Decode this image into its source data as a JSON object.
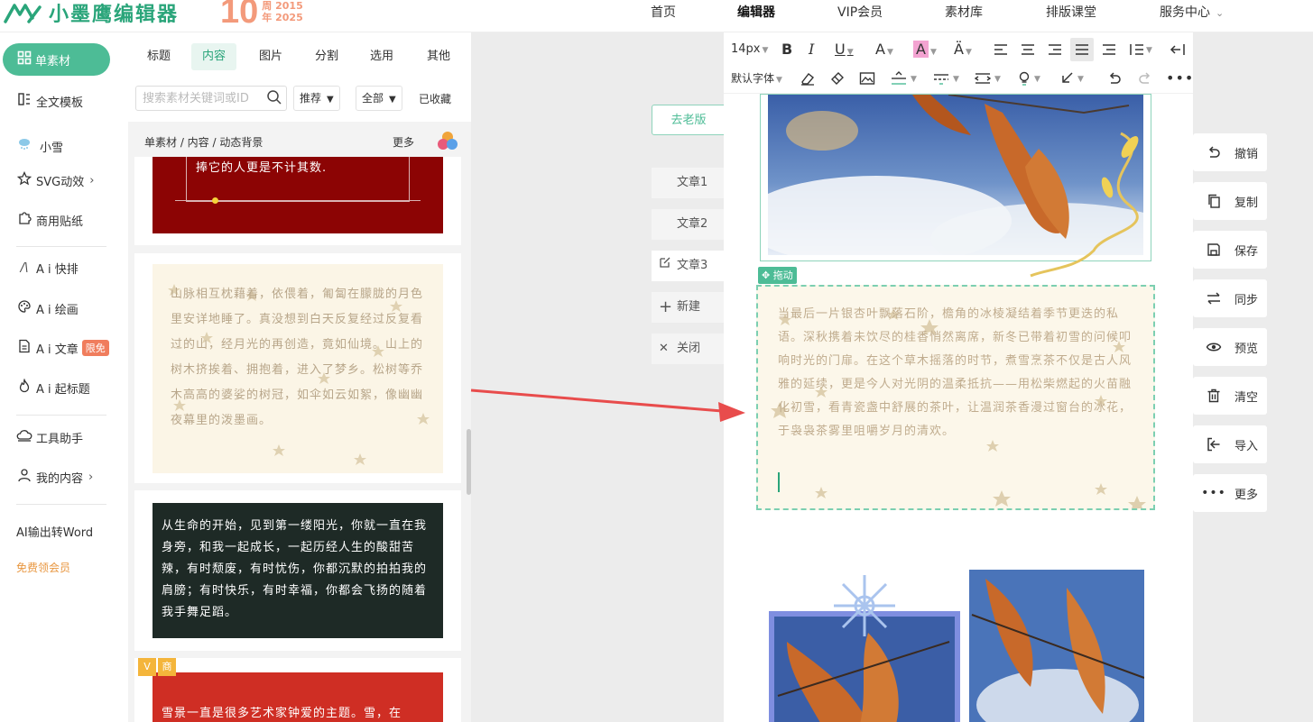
{
  "app": {
    "logo_text": "小墨鹰编辑器",
    "anniversary_number": "10",
    "anniversary_line1": "周 2015",
    "anniversary_line2": "年 2025",
    "brand_color": "#4dbc96"
  },
  "nav": {
    "items": [
      {
        "label": "首页",
        "active": false
      },
      {
        "label": "编辑器",
        "active": true
      },
      {
        "label": "VIP会员",
        "active": false
      },
      {
        "label": "素材库",
        "active": false
      },
      {
        "label": "排版课堂",
        "active": false
      },
      {
        "label": "服务中心",
        "active": false,
        "caret": "⌄"
      }
    ]
  },
  "sidebar": {
    "primary_button": "单素材",
    "items": [
      {
        "label": "全文模板",
        "icon": "template-icon"
      },
      {
        "label": "小雪",
        "icon": "snow-cloud-icon"
      },
      {
        "label": "SVG动效",
        "icon": "star-icon",
        "chevron": "›"
      },
      {
        "label": "商用贴纸",
        "icon": "puzzle-icon"
      },
      {
        "label": "A i 快排",
        "icon": "ai-icon"
      },
      {
        "label": "A i 绘画",
        "icon": "palette-icon"
      },
      {
        "label": "A i 文章",
        "icon": "doc-icon",
        "badge": "限免"
      },
      {
        "label": "A i 起标题",
        "icon": "flame-icon"
      },
      {
        "label": "工具助手",
        "icon": "cloud-tool-icon"
      },
      {
        "label": "我的内容",
        "icon": "user-icon",
        "chevron": "›"
      },
      {
        "label": "AI输出转Word",
        "icon": ""
      },
      {
        "label": "免费领会员",
        "icon": ""
      }
    ]
  },
  "material": {
    "tabs": [
      {
        "label": "标题",
        "active": false
      },
      {
        "label": "内容",
        "active": true
      },
      {
        "label": "图片",
        "active": false
      },
      {
        "label": "分割",
        "active": false
      },
      {
        "label": "选用",
        "active": false
      },
      {
        "label": "其他",
        "active": false
      }
    ],
    "search_placeholder": "搜索素材关键词或ID",
    "filter_sort": "推荐",
    "filter_scope": "全部",
    "collected": "已收藏",
    "breadcrumb": "单素材 / 内容 / 动态背景",
    "more": "更多",
    "cards": [
      {
        "text": "捧它的人更是不计其数."
      },
      {
        "text": "山脉相互枕藉着，依偎着，匍匐在朦胧的月色里安详地睡了。真没想到白天反复经过反复看过的山，经月光的再创造，竟如仙境。山上的树木挤挨着、拥抱着，进入了梦乡。松树等乔木高高的婆娑的树冠，如伞如云如絮，像幽幽夜幕里的泼墨画。"
      },
      {
        "text": "从生命的开始，见到第一缕阳光，你就一直在我身旁，和我一起成长，一起历经人生的酸甜苦辣，有时颓废，有时忧伤，你都沉默的拍拍我的肩膀；有时快乐，有时幸福，你都会飞扬的随着我手舞足蹈。"
      },
      {
        "badges": [
          "V",
          "商"
        ],
        "text": "雪景一直是很多艺术家钟爱的主题。雪，在"
      }
    ]
  },
  "article_tabs": {
    "old_version": "去老版",
    "items": [
      {
        "label": "文章1",
        "active": false
      },
      {
        "label": "文章2",
        "active": false
      },
      {
        "label": "文章3",
        "active": true,
        "icon": "edit-icon"
      },
      {
        "label": "新建",
        "active": false,
        "icon": "plus-icon"
      },
      {
        "label": "关闭",
        "active": false,
        "icon": "close-icon"
      }
    ]
  },
  "editor": {
    "font_size": "14px",
    "font_family": "默认字体",
    "drag_tag": "拖动",
    "selected_text": "当最后一片银杏叶飘落石阶，檐角的冰棱凝结着季节更迭的私语。深秋携着未饮尽的桂香悄然离席，新冬已带着初雪的问候叩响时光的门扉。在这个草木摇落的时节，煮雪烹茶不仅是古人风雅的延续，更是今人对光阴的温柔抵抗——用松柴燃起的火苗融化初雪，看青瓷盏中舒展的茶叶，让温润茶香漫过窗台的冰花，于袅袅茶雾里咀嚼岁月的清欢。"
  },
  "actions": [
    {
      "label": "撤销",
      "icon": "undo-icon"
    },
    {
      "label": "复制",
      "icon": "copy-icon"
    },
    {
      "label": "保存",
      "icon": "save-icon"
    },
    {
      "label": "同步",
      "icon": "sync-icon"
    },
    {
      "label": "预览",
      "icon": "eye-icon"
    },
    {
      "label": "清空",
      "icon": "trash-icon"
    },
    {
      "label": "导入",
      "icon": "import-icon"
    },
    {
      "label": "更多",
      "icon": "more-icon"
    }
  ]
}
